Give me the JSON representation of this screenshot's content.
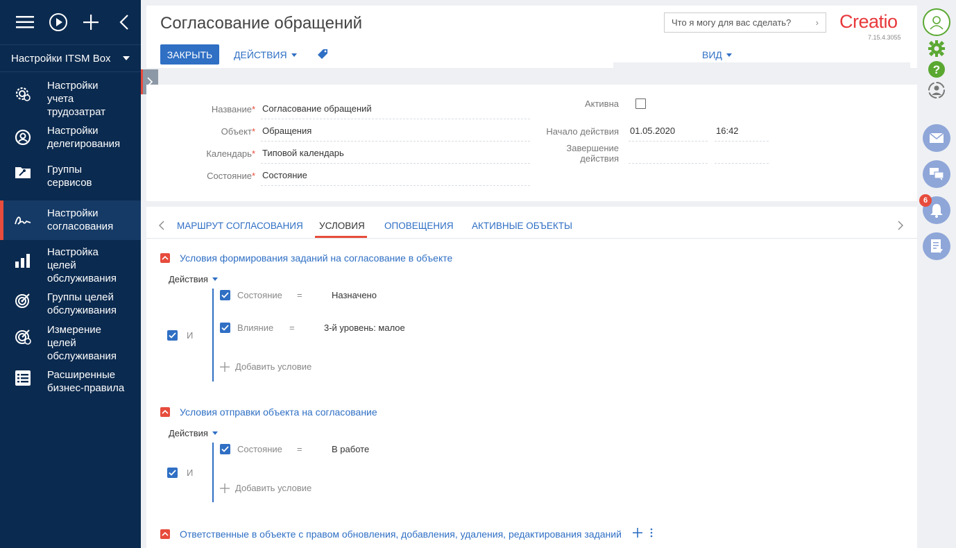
{
  "sidebar": {
    "section_title": "Настройки ITSM Box",
    "items": [
      {
        "label": "Настройки учета трудозатрат",
        "icon": "gear-clock-icon"
      },
      {
        "label": "Настройки делегирования",
        "icon": "user-circle-icon"
      },
      {
        "label": "Группы сервисов",
        "icon": "folder-wrench-icon"
      },
      {
        "label": "Настройки согласования",
        "icon": "signature-icon"
      },
      {
        "label": "Настройка целей обслуживания",
        "icon": "bar-chart-icon"
      },
      {
        "label": "Группы целей обслуживания",
        "icon": "target-icon"
      },
      {
        "label": "Измерение целей обслуживания",
        "icon": "target-gear-icon"
      },
      {
        "label": "Расширенные бизнес-правила",
        "icon": "list-icon"
      }
    ]
  },
  "header": {
    "title": "Согласование обращений",
    "close_label": "ЗАКРЫТЬ",
    "actions_label": "ДЕЙСТВИЯ",
    "view_label": "ВИД",
    "search_placeholder": "Что я могу для вас сделать?",
    "logo_text": "Creatio",
    "version": "7.15.4.3055"
  },
  "fields": {
    "name_label": "Название",
    "name_value": "Согласование обращений",
    "object_label": "Объект",
    "object_value": "Обращения",
    "calendar_label": "Календарь",
    "calendar_value": "Типовой календарь",
    "state_label": "Состояние",
    "state_value": "Состояние",
    "active_label": "Активна",
    "active_checked": false,
    "start_label": "Начало действия",
    "start_date": "01.05.2020",
    "start_time": "16:42",
    "end_label": "Завершение действия"
  },
  "tabs": [
    {
      "label": "МАРШРУТ СОГЛАСОВАНИЯ",
      "active": false
    },
    {
      "label": "УСЛОВИЯ",
      "active": true
    },
    {
      "label": "ОПОВЕЩЕНИЯ",
      "active": false
    },
    {
      "label": "АКТИВНЫЕ ОБЪЕКТЫ",
      "active": false
    }
  ],
  "groups": {
    "g1": {
      "title": "Условия формирования заданий на согласование в объекте",
      "actions_label": "Действия",
      "and_label": "И",
      "conditions": [
        {
          "field": "Состояние",
          "op": "=",
          "value": "Назначено"
        },
        {
          "field": "Влияние",
          "op": "=",
          "value": "3-й уровень: малое"
        }
      ],
      "add_label": "Добавить условие"
    },
    "g2": {
      "title": "Условия отправки объекта на согласование",
      "actions_label": "Действия",
      "and_label": "И",
      "conditions": [
        {
          "field": "Состояние",
          "op": "=",
          "value": "В работе"
        }
      ],
      "add_label": "Добавить условие"
    },
    "g3": {
      "title": "Ответственные в объекте с правом обновления, добавления, удаления, редактирования заданий"
    }
  },
  "rightbar": {
    "notifications_count": "6"
  },
  "colors": {
    "sidebar_bg": "#0b2a4f",
    "accent_blue": "#2f6fc4",
    "accent_red": "#e74c3c",
    "green": "#5aa832"
  }
}
